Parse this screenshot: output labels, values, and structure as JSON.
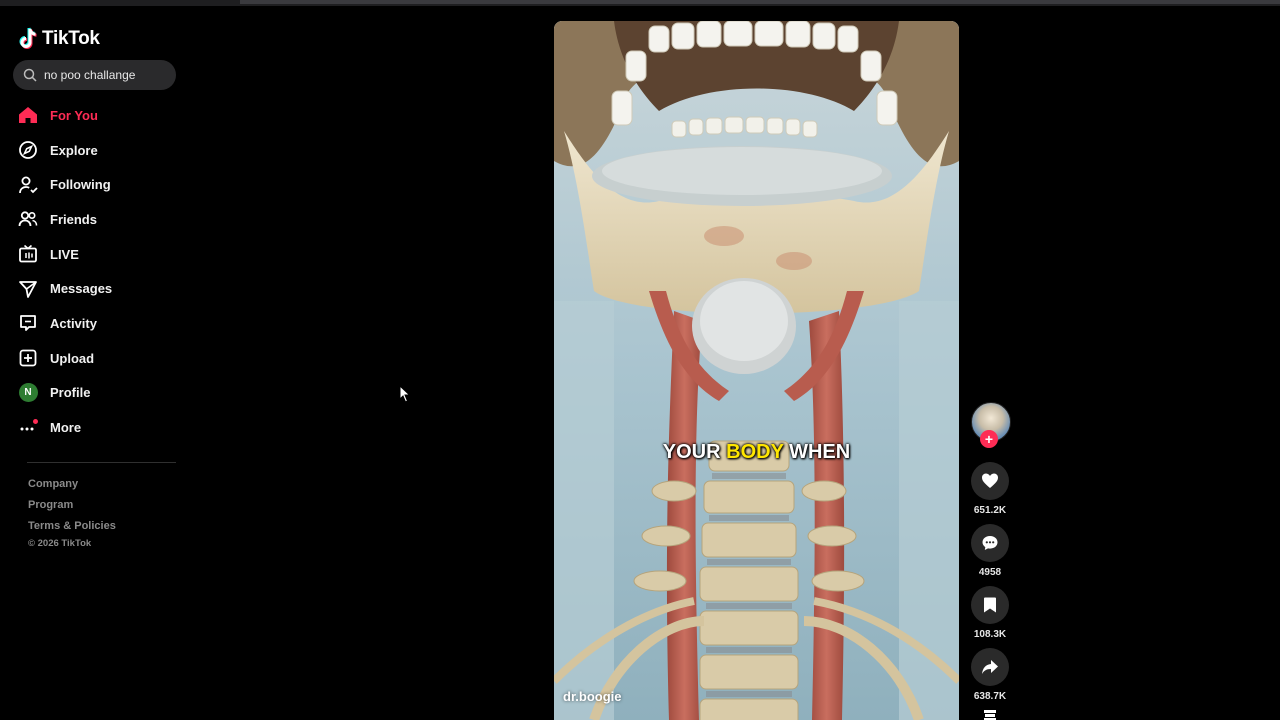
{
  "app": {
    "logo_text": "TikTok"
  },
  "search": {
    "value": "no poo challange"
  },
  "nav": {
    "items": [
      {
        "label": "For You",
        "icon": "home-icon",
        "active": true
      },
      {
        "label": "Explore",
        "icon": "compass-icon"
      },
      {
        "label": "Following",
        "icon": "user-follow-icon"
      },
      {
        "label": "Friends",
        "icon": "friends-icon"
      },
      {
        "label": "LIVE",
        "icon": "live-tv-icon"
      },
      {
        "label": "Messages",
        "icon": "send-icon"
      },
      {
        "label": "Activity",
        "icon": "activity-icon"
      },
      {
        "label": "Upload",
        "icon": "plus-square-icon"
      },
      {
        "label": "Profile",
        "icon": "avatar",
        "avatar_letter": "N"
      },
      {
        "label": "More",
        "icon": "more-dots-icon"
      }
    ]
  },
  "footer": {
    "links": [
      "Company",
      "Program",
      "Terms & Policies"
    ],
    "copyright": "© 2026 TikTok"
  },
  "video": {
    "caption_part1": "YOUR",
    "caption_highlight": "BODY",
    "caption_part2": "WHEN",
    "author": "dr.boogie"
  },
  "actions": {
    "likes": "651.2K",
    "comments": "4958",
    "saves": "108.3K",
    "shares": "638.7K"
  },
  "colors": {
    "accent": "#fe2c55",
    "caption_highlight": "#ffe600",
    "background": "#000000"
  }
}
